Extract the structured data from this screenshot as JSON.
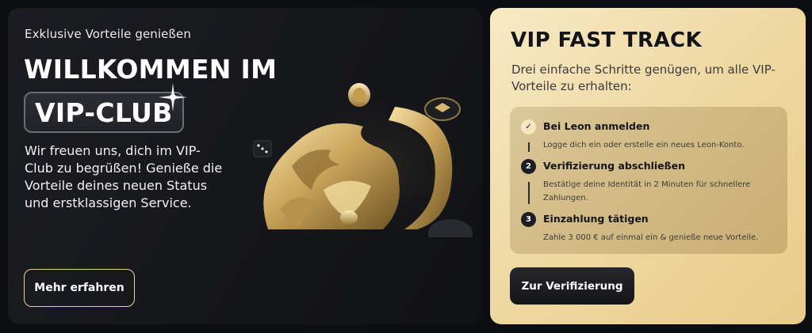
{
  "vip_banner": {
    "eyebrow": "Exklusive Vorteile genießen",
    "title_line1": "WILLKOMMEN IM",
    "title_line2": "VIP-CLUB",
    "description": "Wir freuen uns, dich im VIP-Club zu begrüßen! Genieße die Vorteile deines neuen Status und erstklassigen Service.",
    "more_button": "Mehr erfahren",
    "illustration": "gold-lion-emblem-with-coins-and-dice"
  },
  "fast_track": {
    "title": "VIP FAST TRACK",
    "subtitle": "Drei einfache Schritte genügen, um alle VIP-Vorteile zu erhalten:",
    "steps": [
      {
        "marker": "✓",
        "status": "done",
        "title": "Bei Leon anmelden",
        "text": "Logge dich ein oder erstelle ein neues Leon-Konto."
      },
      {
        "marker": "2",
        "status": "todo",
        "title": "Verifizierung abschließen",
        "text": "Bestätige deine Identität in 2 Minuten für schnellere Zahlungen."
      },
      {
        "marker": "3",
        "status": "todo",
        "title": "Einzahlung tätigen",
        "text": "Zahle 3 000 € auf einmal ein & genieße neue Vorteile."
      }
    ],
    "verify_button": "Zur Verifizierung"
  },
  "colors": {
    "dark_card": "#1a1b1f",
    "gold_card": "#efd9a4",
    "gold_accent": "#e7d4a0",
    "text_dark": "#131417"
  }
}
